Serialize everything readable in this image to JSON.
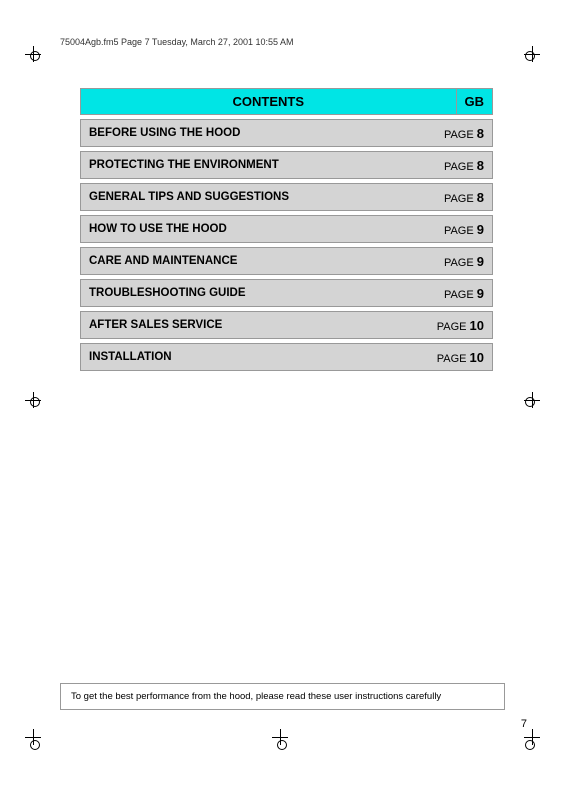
{
  "header": {
    "file_info": "75004Agb.fm5  Page 7  Tuesday, March 27, 2001  10:55 AM"
  },
  "contents": {
    "title": "CONTENTS",
    "gb_label": "GB"
  },
  "toc_rows": [
    {
      "label": "BEFORE USING THE HOOD",
      "page_prefix": "PAGE",
      "page_num": "8"
    },
    {
      "label": "PROTECTING THE ENVIRONMENT",
      "page_prefix": "PAGE",
      "page_num": "8"
    },
    {
      "label": "GENERAL TIPS AND SUGGESTIONS",
      "page_prefix": "PAGE",
      "page_num": "8"
    },
    {
      "label": "HOW TO USE THE HOOD",
      "page_prefix": "PAGE",
      "page_num": "9"
    },
    {
      "label": "CARE AND MAINTENANCE",
      "page_prefix": "PAGE",
      "page_num": "9"
    },
    {
      "label": "TROUBLESHOOTING GUIDE",
      "page_prefix": "PAGE",
      "page_num": "9"
    },
    {
      "label": "AFTER SALES SERVICE",
      "page_prefix": "PAGE",
      "page_num": "10"
    },
    {
      "label": "INSTALLATION",
      "page_prefix": "PAGE",
      "page_num": "10"
    }
  ],
  "footer": {
    "note": "To get the best performance from the hood, please read these user instructions carefully"
  },
  "page_number": "7"
}
